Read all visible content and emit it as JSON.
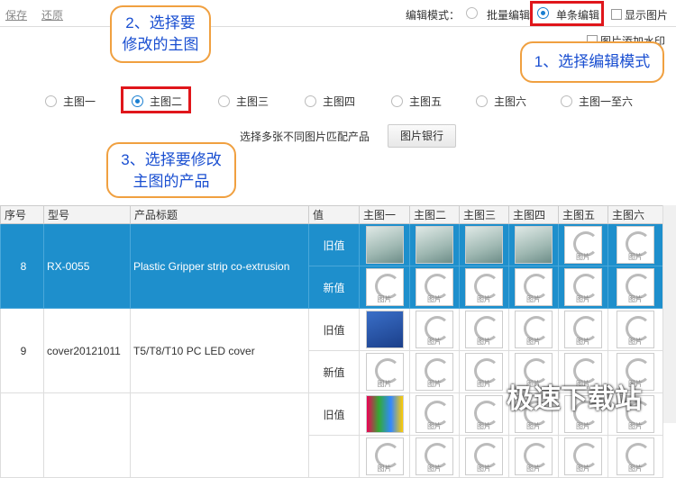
{
  "toolbar": {
    "save": "保存",
    "restore": "还原",
    "mode_label": "编辑模式：",
    "batch": "批量编辑",
    "single": "单条编辑",
    "show_image": "显示图片",
    "watermark": "图片添加水印"
  },
  "images": [
    "主图一",
    "主图二",
    "主图三",
    "主图四",
    "主图五",
    "主图六",
    "主图一至六"
  ],
  "match_text": "选择多张不同图片匹配产品",
  "bank_button": "图片银行",
  "callouts": {
    "c1": "1、选择编辑模式",
    "c2a": "2、选择要",
    "c2b": "修改的主图",
    "c3a": "3、选择要修改",
    "c3b": "主图的产品"
  },
  "table": {
    "headers": [
      "序号",
      "型号",
      "产品标题",
      "值",
      "主图一",
      "主图二",
      "主图三",
      "主图四",
      "主图五",
      "主图六"
    ],
    "rows": [
      {
        "no": "8",
        "model": "RX-0055",
        "title": "Plastic Gripper strip co-extrusion",
        "old": "旧值",
        "new": "新值"
      },
      {
        "no": "9",
        "model": "cover20121011",
        "title": "T5/T8/T10 PC LED cover",
        "old": "旧值",
        "new": "新值"
      },
      {
        "no": "",
        "model": "",
        "title": "",
        "old": "旧值",
        "new": ""
      }
    ]
  },
  "watermark": "极速下载站"
}
